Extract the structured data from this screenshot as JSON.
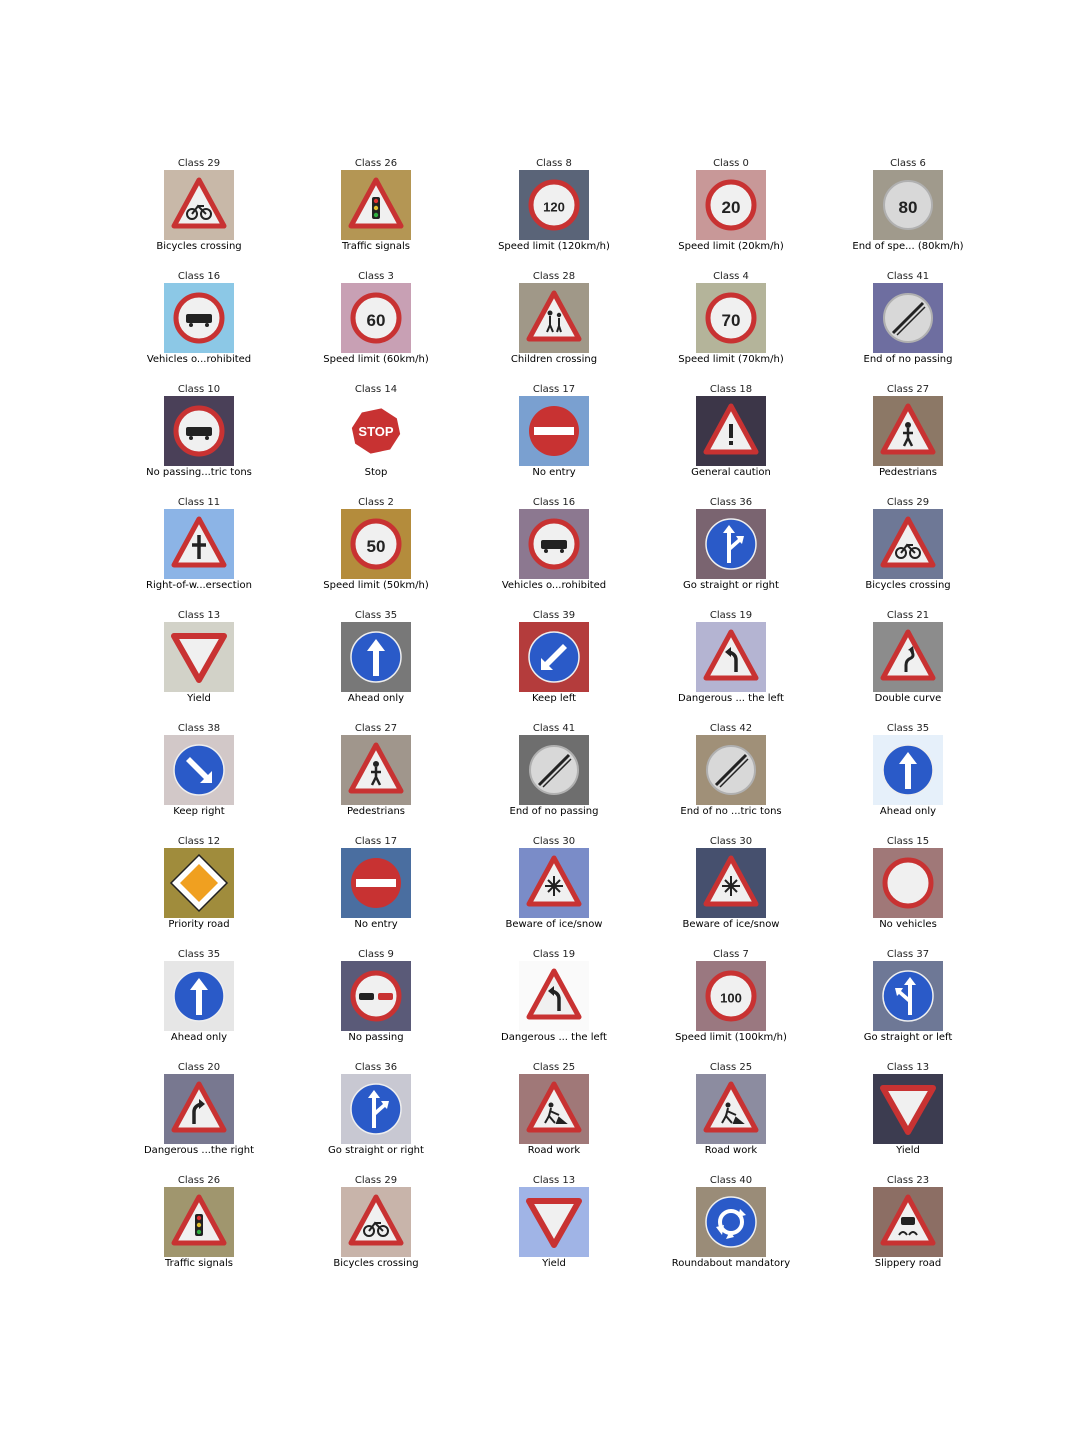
{
  "grid": {
    "rows": [
      [
        {
          "cls": "Class 29",
          "name": "Bicycles crossing",
          "sign": "triangle",
          "symbol": "bike",
          "bg": "#c8b8a8",
          "text": ""
        },
        {
          "cls": "Class 26",
          "name": "Traffic signals",
          "sign": "triangle",
          "symbol": "lights",
          "bg": "#b49654",
          "text": ""
        },
        {
          "cls": "Class 8",
          "name": "Speed limit (120km/h)",
          "sign": "circle-red",
          "symbol": "text",
          "bg": "#5a6478",
          "text": "120"
        },
        {
          "cls": "Class 0",
          "name": "Speed limit (20km/h)",
          "sign": "circle-red",
          "symbol": "text",
          "bg": "#c89898",
          "text": "20"
        },
        {
          "cls": "Class 6",
          "name": "End of spe... (80km/h)",
          "sign": "circle-grey",
          "symbol": "text",
          "bg": "#a09a8c",
          "text": "80"
        }
      ],
      [
        {
          "cls": "Class 16",
          "name": "Vehicles o...rohibited",
          "sign": "circle-red",
          "symbol": "truck",
          "bg": "#8cc8e6",
          "text": ""
        },
        {
          "cls": "Class 3",
          "name": "Speed limit (60km/h)",
          "sign": "circle-red",
          "symbol": "text",
          "bg": "#c8a0b4",
          "text": "60"
        },
        {
          "cls": "Class 28",
          "name": "Children crossing",
          "sign": "triangle",
          "symbol": "children",
          "bg": "#a09888",
          "text": ""
        },
        {
          "cls": "Class 4",
          "name": "Speed limit (70km/h)",
          "sign": "circle-red",
          "symbol": "text",
          "bg": "#b4b49a",
          "text": "70"
        },
        {
          "cls": "Class 41",
          "name": "End of no passing",
          "sign": "circle-grey",
          "symbol": "slash",
          "bg": "#6e6ea0",
          "text": ""
        }
      ],
      [
        {
          "cls": "Class 10",
          "name": "No passing...tric tons",
          "sign": "circle-red",
          "symbol": "truck",
          "bg": "#4a4058",
          "text": ""
        },
        {
          "cls": "Class 14",
          "name": "Stop",
          "sign": "octagon",
          "symbol": "stop",
          "bg": "#ffffff",
          "text": "STOP"
        },
        {
          "cls": "Class 17",
          "name": "No entry",
          "sign": "no-entry",
          "symbol": "bar",
          "bg": "#7aa0d0",
          "text": ""
        },
        {
          "cls": "Class 18",
          "name": "General caution",
          "sign": "triangle",
          "symbol": "exclaim",
          "bg": "#3c3648",
          "text": ""
        },
        {
          "cls": "Class 27",
          "name": "Pedestrians",
          "sign": "triangle",
          "symbol": "person",
          "bg": "#8c7866",
          "text": ""
        }
      ],
      [
        {
          "cls": "Class 11",
          "name": "Right-of-w...ersection",
          "sign": "triangle",
          "symbol": "cross",
          "bg": "#8cb4e6",
          "text": ""
        },
        {
          "cls": "Class 2",
          "name": "Speed limit (50km/h)",
          "sign": "circle-red",
          "symbol": "text",
          "bg": "#b48c3c",
          "text": "50"
        },
        {
          "cls": "Class 16",
          "name": "Vehicles o...rohibited",
          "sign": "circle-red",
          "symbol": "truck",
          "bg": "#8c7890",
          "text": ""
        },
        {
          "cls": "Class 36",
          "name": "Go straight or right",
          "sign": "circle-blue",
          "symbol": "straight-right",
          "bg": "#7a6470",
          "text": ""
        },
        {
          "cls": "Class 29",
          "name": "Bicycles crossing",
          "sign": "triangle",
          "symbol": "bike",
          "bg": "#6e7896",
          "text": ""
        }
      ],
      [
        {
          "cls": "Class 13",
          "name": "Yield",
          "sign": "yield",
          "symbol": "none",
          "bg": "#d2d2c8",
          "text": ""
        },
        {
          "cls": "Class 35",
          "name": "Ahead only",
          "sign": "circle-blue",
          "symbol": "up",
          "bg": "#787878",
          "text": ""
        },
        {
          "cls": "Class 39",
          "name": "Keep left",
          "sign": "circle-blue",
          "symbol": "down-left",
          "bg": "#b43c3c",
          "text": ""
        },
        {
          "cls": "Class 19",
          "name": "Dangerous ... the left",
          "sign": "triangle",
          "symbol": "curve-left",
          "bg": "#b4b4d2",
          "text": ""
        },
        {
          "cls": "Class 21",
          "name": "Double curve",
          "sign": "triangle",
          "symbol": "double-curve",
          "bg": "#8c8c8c",
          "text": ""
        }
      ],
      [
        {
          "cls": "Class 38",
          "name": "Keep right",
          "sign": "circle-blue",
          "symbol": "down-right",
          "bg": "#d2c8c8",
          "text": ""
        },
        {
          "cls": "Class 27",
          "name": "Pedestrians",
          "sign": "triangle",
          "symbol": "person",
          "bg": "#a0968c",
          "text": ""
        },
        {
          "cls": "Class 41",
          "name": "End of no passing",
          "sign": "circle-grey",
          "symbol": "slash",
          "bg": "#6e6e6e",
          "text": ""
        },
        {
          "cls": "Class 42",
          "name": "End of no ...tric tons",
          "sign": "circle-grey",
          "symbol": "slash",
          "bg": "#a09078",
          "text": ""
        },
        {
          "cls": "Class 35",
          "name": "Ahead only",
          "sign": "circle-blue",
          "symbol": "up",
          "bg": "#e6f0fa",
          "text": ""
        }
      ],
      [
        {
          "cls": "Class 12",
          "name": "Priority road",
          "sign": "diamond",
          "symbol": "none",
          "bg": "#a08c3c",
          "text": ""
        },
        {
          "cls": "Class 17",
          "name": "No entry",
          "sign": "no-entry",
          "symbol": "bar",
          "bg": "#4a6ea0",
          "text": ""
        },
        {
          "cls": "Class 30",
          "name": "Beware of ice/snow",
          "sign": "triangle",
          "symbol": "snow",
          "bg": "#7a8cc8",
          "text": ""
        },
        {
          "cls": "Class 30",
          "name": "Beware of ice/snow",
          "sign": "triangle",
          "symbol": "snow",
          "bg": "#46506e",
          "text": ""
        },
        {
          "cls": "Class 15",
          "name": "No vehicles",
          "sign": "circle-red",
          "symbol": "none",
          "bg": "#a07878",
          "text": ""
        }
      ],
      [
        {
          "cls": "Class 35",
          "name": "Ahead only",
          "sign": "circle-blue",
          "symbol": "up",
          "bg": "#e6e6e6",
          "text": ""
        },
        {
          "cls": "Class 9",
          "name": "No passing",
          "sign": "circle-red",
          "symbol": "cars",
          "bg": "#5a5a78",
          "text": ""
        },
        {
          "cls": "Class 19",
          "name": "Dangerous ... the left",
          "sign": "triangle",
          "symbol": "curve-left",
          "bg": "#fafafa",
          "text": ""
        },
        {
          "cls": "Class 7",
          "name": "Speed limit (100km/h)",
          "sign": "circle-red",
          "symbol": "text",
          "bg": "#9a7880",
          "text": "100"
        },
        {
          "cls": "Class 37",
          "name": "Go straight or left",
          "sign": "circle-blue",
          "symbol": "straight-left",
          "bg": "#6e7896",
          "text": ""
        }
      ],
      [
        {
          "cls": "Class 20",
          "name": "Dangerous ...the right",
          "sign": "triangle",
          "symbol": "curve-right",
          "bg": "#787890",
          "text": ""
        },
        {
          "cls": "Class 36",
          "name": "Go straight or right",
          "sign": "circle-blue",
          "symbol": "straight-right",
          "bg": "#c8c8d2",
          "text": ""
        },
        {
          "cls": "Class 25",
          "name": "Road work",
          "sign": "triangle",
          "symbol": "work",
          "bg": "#a07878",
          "text": ""
        },
        {
          "cls": "Class 25",
          "name": "Road work",
          "sign": "triangle",
          "symbol": "work",
          "bg": "#8c8ca0",
          "text": ""
        },
        {
          "cls": "Class 13",
          "name": "Yield",
          "sign": "yield",
          "symbol": "none",
          "bg": "#3c3c50",
          "text": ""
        }
      ],
      [
        {
          "cls": "Class 26",
          "name": "Traffic signals",
          "sign": "triangle",
          "symbol": "lights",
          "bg": "#a0966e",
          "text": ""
        },
        {
          "cls": "Class 29",
          "name": "Bicycles crossing",
          "sign": "triangle",
          "symbol": "bike",
          "bg": "#c8b4aa",
          "text": ""
        },
        {
          "cls": "Class 13",
          "name": "Yield",
          "sign": "yield",
          "symbol": "none",
          "bg": "#a0b4e6",
          "text": ""
        },
        {
          "cls": "Class 40",
          "name": "Roundabout mandatory",
          "sign": "circle-blue",
          "symbol": "roundabout",
          "bg": "#9a8c78",
          "text": ""
        },
        {
          "cls": "Class 23",
          "name": "Slippery road",
          "sign": "triangle",
          "symbol": "slippery",
          "bg": "#8c6e64",
          "text": ""
        }
      ]
    ]
  },
  "colors": {
    "red": "#c83232",
    "blue": "#2a5ac8",
    "white": "#f0f0f0",
    "grey": "#d8d8d8",
    "black": "#222222",
    "priority": "#f0a020"
  }
}
